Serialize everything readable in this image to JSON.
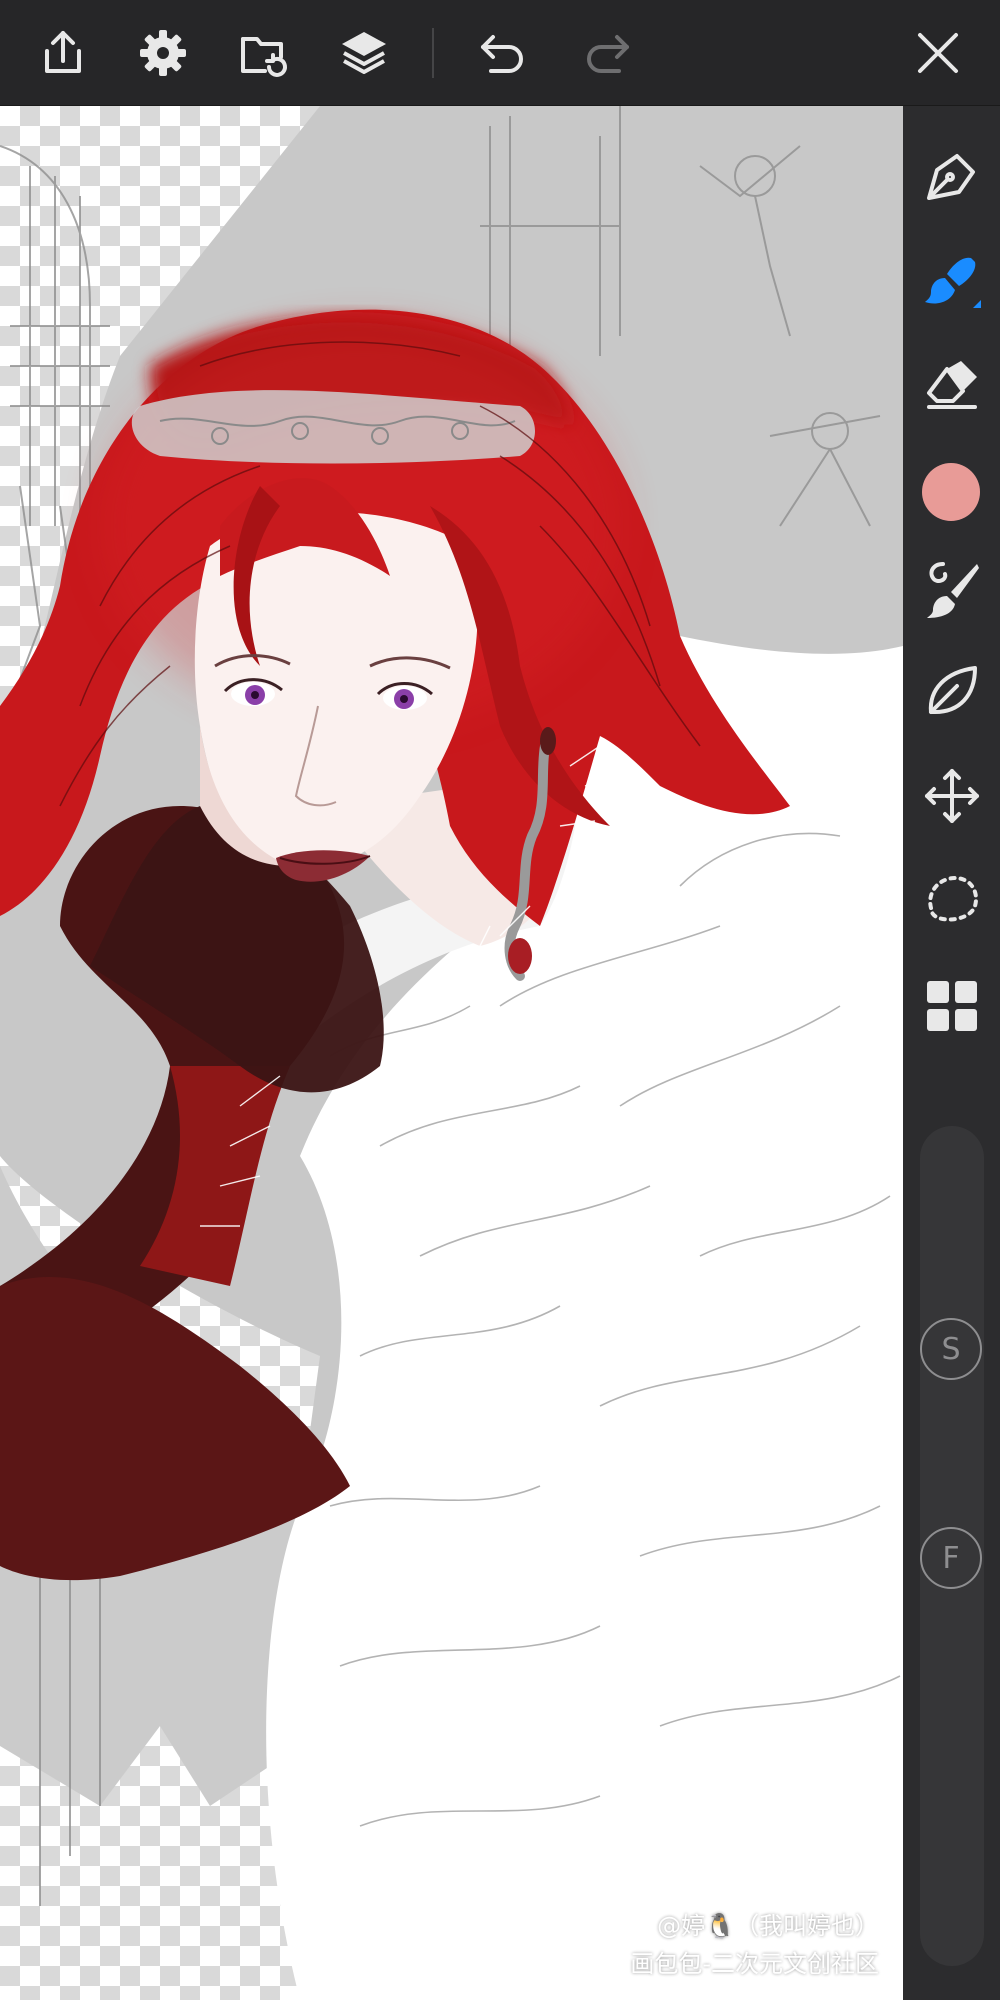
{
  "toolbar": {
    "buttons": [
      {
        "name": "share-button",
        "icon": "share-icon"
      },
      {
        "name": "settings-button",
        "icon": "gear-icon"
      },
      {
        "name": "gallery-button",
        "icon": "folder-icon"
      },
      {
        "name": "layers-button",
        "icon": "layers-icon"
      },
      {
        "name": "undo-button",
        "icon": "undo-icon"
      },
      {
        "name": "redo-button",
        "icon": "redo-icon"
      },
      {
        "name": "close-button",
        "icon": "close-icon"
      }
    ]
  },
  "tools": [
    {
      "name": "pen-tool",
      "icon": "pen-nib-icon",
      "active": false
    },
    {
      "name": "brush-tool",
      "icon": "brush-icon",
      "active": true
    },
    {
      "name": "eraser-tool",
      "icon": "eraser-icon",
      "active": false
    },
    {
      "name": "color-picker",
      "icon": "color-swatch",
      "active": false
    },
    {
      "name": "brush-settings-tool",
      "icon": "brush-palette-icon",
      "active": false
    },
    {
      "name": "smudge-tool",
      "icon": "leaf-icon",
      "active": false
    },
    {
      "name": "transform-tool",
      "icon": "move-arrows-icon",
      "active": false
    },
    {
      "name": "lasso-tool",
      "icon": "lasso-icon",
      "active": false
    },
    {
      "name": "materials-tool",
      "icon": "grid-icon",
      "active": false
    }
  ],
  "colors": {
    "toolbar_bg": "#262628",
    "rail_bg": "#2c2c2e",
    "accent": "#1a8cff",
    "current_color": "#e89b97",
    "icon": "#e8e8e8",
    "icon_disabled": "#6e6e70"
  },
  "sliders": {
    "size_label": "S",
    "flow_label": "F"
  },
  "watermark": {
    "line1": "@婷🐧（我叫婷也）",
    "line2": "画包包-二次元文创社区"
  }
}
